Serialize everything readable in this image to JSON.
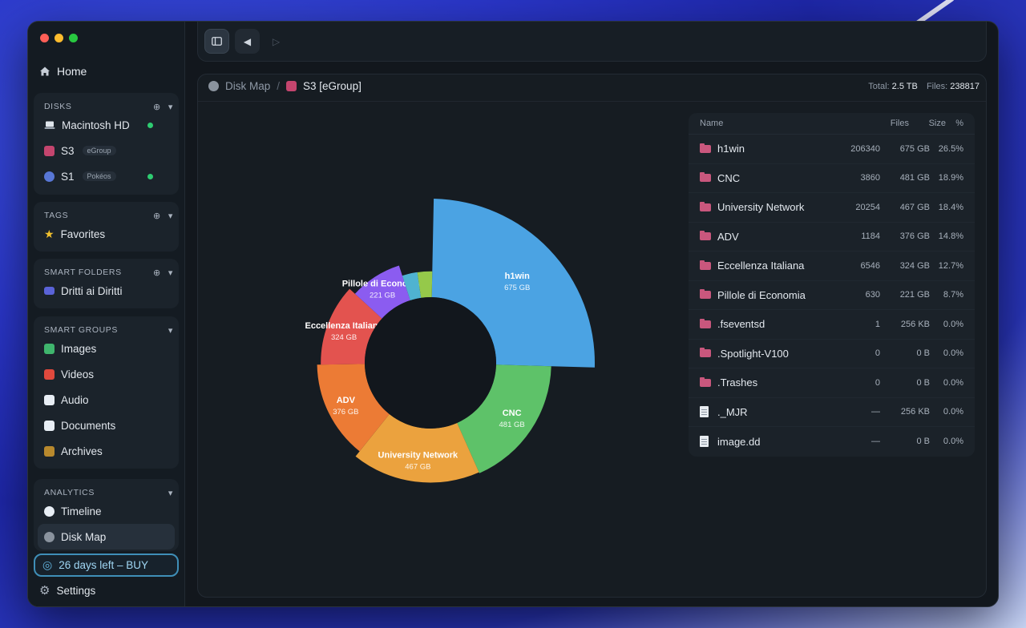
{
  "sidebar": {
    "home": "Home",
    "disks": {
      "header": "DISKS",
      "items": [
        {
          "label": "Macintosh HD",
          "tag": "",
          "online": true
        },
        {
          "label": "S3",
          "tag": "eGroup",
          "online": false
        },
        {
          "label": "S1",
          "tag": "Pokéos",
          "online": true
        }
      ]
    },
    "tags": {
      "header": "TAGS",
      "items": [
        {
          "label": "Favorites"
        }
      ]
    },
    "smart_folders": {
      "header": "SMART FOLDERS",
      "items": [
        {
          "label": "Dritti ai Diritti"
        }
      ]
    },
    "smart_groups": {
      "header": "SMART GROUPS",
      "items": [
        {
          "label": "Images"
        },
        {
          "label": "Videos"
        },
        {
          "label": "Audio"
        },
        {
          "label": "Documents"
        },
        {
          "label": "Archives"
        }
      ]
    },
    "analytics": {
      "header": "ANALYTICS",
      "items": [
        {
          "label": "Timeline"
        },
        {
          "label": "Disk Map"
        }
      ]
    },
    "buy": "26 days left – BUY",
    "settings": "Settings"
  },
  "breadcrumb": {
    "root": "Disk Map",
    "current": "S3 [eGroup]"
  },
  "stats": {
    "total_label": "Total:",
    "total_value": "2.5 TB",
    "files_label": "Files:",
    "files_value": "238817"
  },
  "table": {
    "headers": {
      "name": "Name",
      "files": "Files",
      "size": "Size",
      "pct": "%"
    },
    "rows": [
      {
        "name": "h1win",
        "files": "206340",
        "size": "675 GB",
        "pct": "26.5%",
        "type": "folder"
      },
      {
        "name": "CNC",
        "files": "3860",
        "size": "481 GB",
        "pct": "18.9%",
        "type": "folder"
      },
      {
        "name": "University Network",
        "files": "20254",
        "size": "467 GB",
        "pct": "18.4%",
        "type": "folder"
      },
      {
        "name": "ADV",
        "files": "1184",
        "size": "376 GB",
        "pct": "14.8%",
        "type": "folder"
      },
      {
        "name": "Eccellenza Italiana",
        "files": "6546",
        "size": "324 GB",
        "pct": "12.7%",
        "type": "folder"
      },
      {
        "name": "Pillole di Economia",
        "files": "630",
        "size": "221 GB",
        "pct": "8.7%",
        "type": "folder"
      },
      {
        "name": ".fseventsd",
        "files": "1",
        "size": "256 KB",
        "pct": "0.0%",
        "type": "folder"
      },
      {
        "name": ".Spotlight-V100",
        "files": "0",
        "size": "0 B",
        "pct": "0.0%",
        "type": "folder"
      },
      {
        "name": ".Trashes",
        "files": "0",
        "size": "0 B",
        "pct": "0.0%",
        "type": "folder"
      },
      {
        "name": "._MJR",
        "files": "—",
        "size": "256 KB",
        "pct": "0.0%",
        "type": "file"
      },
      {
        "name": "image.dd",
        "files": "—",
        "size": "0 B",
        "pct": "0.0%",
        "type": "file"
      }
    ]
  },
  "chart_data": {
    "type": "pie",
    "segments": [
      {
        "label": "h1win",
        "size": "675 GB",
        "value": 675,
        "color": "#4ba3e3"
      },
      {
        "label": "CNC",
        "size": "481 GB",
        "value": 481,
        "color": "#5ec269"
      },
      {
        "label": "University Network",
        "size": "467 GB",
        "value": 467,
        "color": "#eba23e"
      },
      {
        "label": "ADV",
        "size": "376 GB",
        "value": 376,
        "color": "#ec7b35"
      },
      {
        "label": "Eccellenza Italiana",
        "size": "324 GB",
        "value": 324,
        "color": "#e3534f"
      },
      {
        "label": "Pillole di Economia",
        "size": "221 GB",
        "value": 221,
        "color": "#8b5cf0"
      },
      {
        "label": "",
        "size": "",
        "value": 72,
        "color": "#4fb3d1"
      },
      {
        "label": "",
        "size": "",
        "value": 70,
        "color": "#95c94a"
      }
    ]
  }
}
